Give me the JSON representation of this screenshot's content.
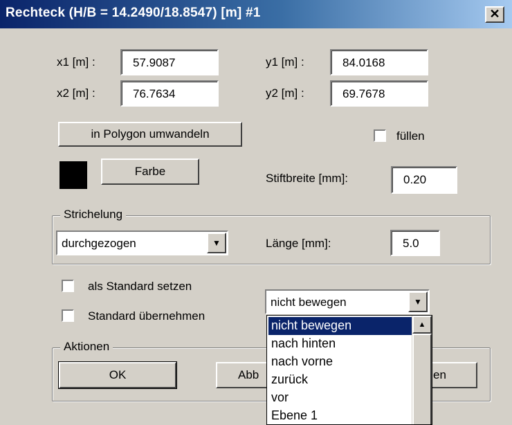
{
  "window": {
    "title": "Rechteck (H/B = 14.2490/18.8547) [m]  #1",
    "close_glyph": "✕"
  },
  "coords": {
    "x1_label": "x1 [m] :",
    "x1_value": "57.9087",
    "x2_label": "x2 [m] :",
    "x2_value": "76.7634",
    "y1_label": "y1 [m] :",
    "y1_value": "84.0168",
    "y2_label": "y2 [m] :",
    "y2_value": "69.7678"
  },
  "polygon_button": "in Polygon umwandeln",
  "fill": {
    "label": "füllen",
    "checked": false
  },
  "color": {
    "swatch": "#000000",
    "button": "Farbe"
  },
  "pen": {
    "label": "Stiftbreite [mm]:",
    "value": "0.20"
  },
  "dash": {
    "group_title": "Strichelung",
    "style_selected": "durchgezogen",
    "length_label": "Länge [mm]:",
    "length_value": "5.0"
  },
  "standard": {
    "set_label": "als Standard setzen",
    "apply_label": "Standard übernehmen"
  },
  "move": {
    "selected": "nicht bewegen",
    "options": [
      "nicht bewegen",
      "nach hinten",
      "nach vorne",
      "zurück",
      "vor",
      "Ebene 1"
    ]
  },
  "actions": {
    "group_title": "Aktionen",
    "ok": "OK",
    "cancel_visible": "Abb",
    "third_visible": "en"
  },
  "icons": {
    "dropdown_arrow": "▼",
    "scroll_up": "▲"
  }
}
